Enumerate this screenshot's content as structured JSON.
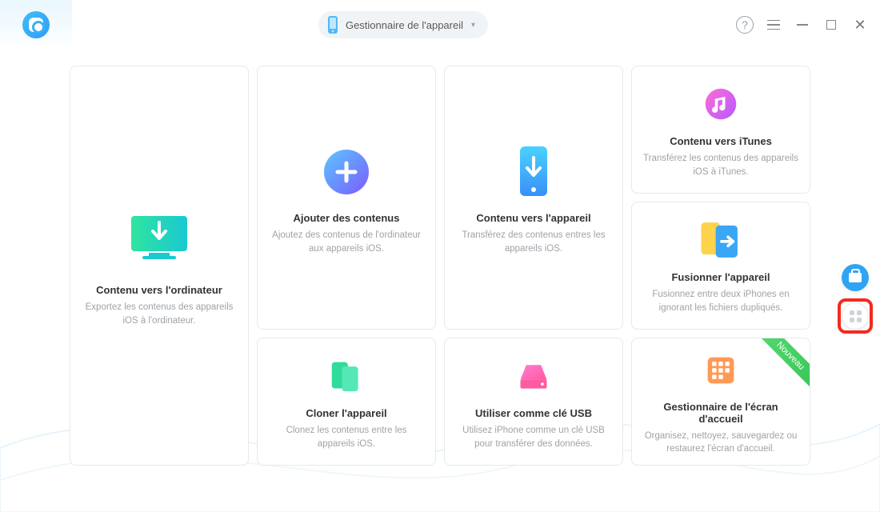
{
  "header": {
    "device_label": "Gestionnaire de l'appareil"
  },
  "cards": {
    "to_computer": {
      "title": "Contenu vers l'ordinateur",
      "desc": "Exportez les contenus des appareils iOS à l'ordinateur."
    },
    "add_content": {
      "title": "Ajouter des contenus",
      "desc": "Ajoutez des contenus de l'ordinateur aux appareils iOS."
    },
    "to_device": {
      "title": "Contenu vers l'appareil",
      "desc": "Transférez des contenus entres les appareils iOS."
    },
    "to_itunes": {
      "title": "Contenu vers iTunes",
      "desc": "Transférez les contenus des appareils iOS à iTunes."
    },
    "merge_device": {
      "title": "Fusionner l'appareil",
      "desc": "Fusionnez entre deux iPhones en ignorant les fichiers dupliqués."
    },
    "clone_device": {
      "title": "Cloner l'appareil",
      "desc": "Clonez les contenus entre les appareils iOS."
    },
    "usb_drive": {
      "title": "Utiliser comme clé USB",
      "desc": "Utilisez iPhone comme un clé USB pour transférer des données."
    },
    "home_screen": {
      "title": "Gestionnaire de l'écran d'accueil",
      "desc": "Organisez, nettoyez, sauvegardez ou restaurez l'écran d'accueil.",
      "badge": "Nouveau"
    }
  }
}
